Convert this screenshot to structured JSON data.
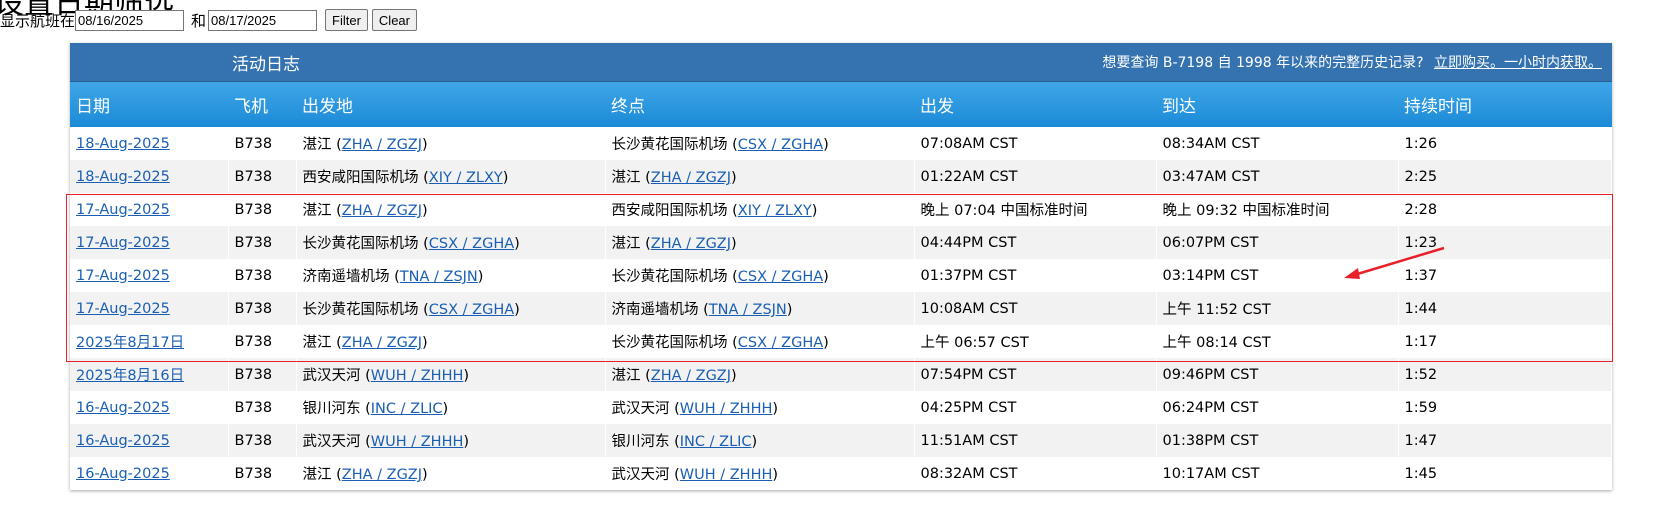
{
  "page": {
    "title": "设置日期筛选"
  },
  "filter": {
    "prefix_label": "显示航班在",
    "start_value": "08/16/2025",
    "joiner_label": "和",
    "end_value": "08/17/2025",
    "filter_button": "Filter",
    "clear_button": "Clear"
  },
  "log": {
    "title": "活动日志",
    "promo_text": "想要查询 B-7198 自 1998 年以来的完整历史记录?",
    "promo_link": "立即购买。一小时内获取。",
    "columns": [
      "日期",
      "飞机",
      "出发地",
      "终点",
      "出发",
      "到达",
      "持续时间"
    ],
    "rows": [
      {
        "date": "18-Aug-2025",
        "aircraft": "B738",
        "origin_name": "湛江",
        "origin_code": "ZHA / ZGZJ",
        "dest_name": "长沙黄花国际机场",
        "dest_code": "CSX / ZGHA",
        "depart": "07:08AM CST",
        "arrive": "08:34AM CST",
        "duration": "1:26"
      },
      {
        "date": "18-Aug-2025",
        "aircraft": "B738",
        "origin_name": "西安咸阳国际机场",
        "origin_code": "XIY / ZLXY",
        "dest_name": "湛江",
        "dest_code": "ZHA / ZGZJ",
        "depart": "01:22AM CST",
        "arrive": "03:47AM CST",
        "duration": "2:25"
      },
      {
        "date": "17-Aug-2025",
        "aircraft": "B738",
        "origin_name": "湛江",
        "origin_code": "ZHA / ZGZJ",
        "dest_name": "西安咸阳国际机场",
        "dest_code": "XIY / ZLXY",
        "depart": "晚上 07:04 中国标准时间",
        "arrive": "晚上 09:32 中国标准时间",
        "duration": "2:28"
      },
      {
        "date": "17-Aug-2025",
        "aircraft": "B738",
        "origin_name": "长沙黄花国际机场",
        "origin_code": "CSX / ZGHA",
        "dest_name": "湛江",
        "dest_code": "ZHA / ZGZJ",
        "depart": "04:44PM CST",
        "arrive": "06:07PM CST",
        "duration": "1:23"
      },
      {
        "date": "17-Aug-2025",
        "aircraft": "B738",
        "origin_name": "济南遥墙机场",
        "origin_code": "TNA / ZSJN",
        "dest_name": "长沙黄花国际机场",
        "dest_code": "CSX / ZGHA",
        "depart": "01:37PM CST",
        "arrive": "03:14PM CST",
        "duration": "1:37"
      },
      {
        "date": "17-Aug-2025",
        "aircraft": "B738",
        "origin_name": "长沙黄花国际机场",
        "origin_code": "CSX / ZGHA",
        "dest_name": "济南遥墙机场",
        "dest_code": "TNA / ZSJN",
        "depart": "10:08AM CST",
        "arrive": "上午 11:52 CST",
        "duration": "1:44"
      },
      {
        "date": "2025年8月17日",
        "aircraft": "B738",
        "origin_name": "湛江",
        "origin_code": "ZHA / ZGZJ",
        "dest_name": "长沙黄花国际机场",
        "dest_code": "CSX / ZGHA",
        "depart": "上午 06:57 CST",
        "arrive": "上午 08:14 CST",
        "duration": "1:17"
      },
      {
        "date": "2025年8月16日",
        "aircraft": "B738",
        "origin_name": "武汉天河",
        "origin_code": "WUH / ZHHH",
        "dest_name": "湛江",
        "dest_code": "ZHA / ZGZJ",
        "depart": "07:54PM CST",
        "arrive": "09:46PM CST",
        "duration": "1:52"
      },
      {
        "date": "16-Aug-2025",
        "aircraft": "B738",
        "origin_name": "银川河东",
        "origin_code": "INC / ZLIC",
        "dest_name": "武汉天河",
        "dest_code": "WUH / ZHHH",
        "depart": "04:25PM CST",
        "arrive": "06:24PM CST",
        "duration": "1:59"
      },
      {
        "date": "16-Aug-2025",
        "aircraft": "B738",
        "origin_name": "武汉天河",
        "origin_code": "WUH / ZHHH",
        "dest_name": "银川河东",
        "dest_code": "INC / ZLIC",
        "depart": "11:51AM CST",
        "arrive": "01:38PM CST",
        "duration": "1:47"
      },
      {
        "date": "16-Aug-2025",
        "aircraft": "B738",
        "origin_name": "湛江",
        "origin_code": "ZHA / ZGZJ",
        "dest_name": "武汉天河",
        "dest_code": "WUH / ZHHH",
        "depart": "08:32AM CST",
        "arrive": "10:17AM CST",
        "duration": "1:45"
      }
    ]
  },
  "annotation": {
    "color": "#e8202a",
    "shape": "red-rectangle-and-arrow"
  },
  "colors": {
    "header_dark": "#3572b0",
    "header_light": "#1b8ad6",
    "link": "#1a5fb4"
  }
}
